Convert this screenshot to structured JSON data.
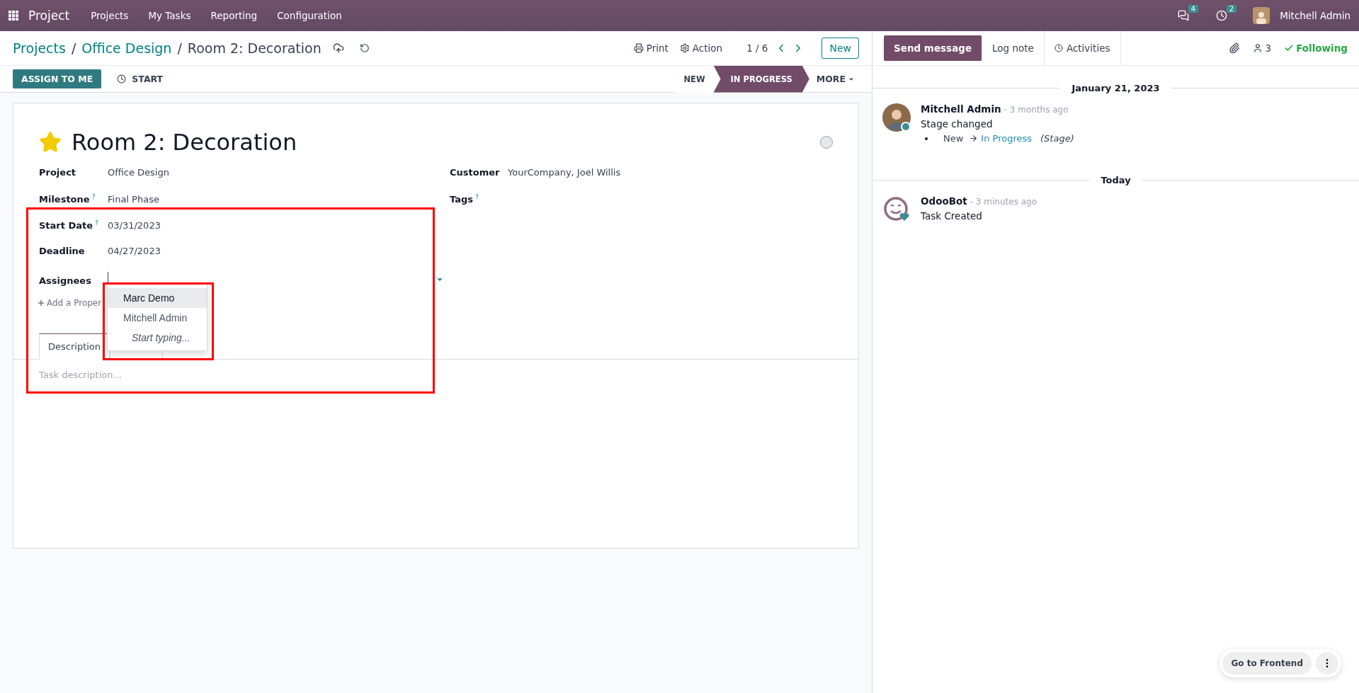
{
  "navbar": {
    "app": "Project",
    "menu": [
      "Projects",
      "My Tasks",
      "Reporting",
      "Configuration"
    ],
    "messages_count": "4",
    "activities_count": "2",
    "user": "Mitchell Admin"
  },
  "breadcrumbs": [
    "Projects",
    "Office Design",
    "Room 2: Decoration"
  ],
  "breadcrumb_separator": "/",
  "actions": [
    "Print",
    "Action"
  ],
  "pager": "1 / 6",
  "new_button": "New",
  "status_buttons": [
    {
      "label": "ASSIGN TO ME",
      "kind": "primary"
    },
    {
      "label": "START",
      "kind": "link"
    }
  ],
  "stages": [
    {
      "label": "NEW",
      "selected": false
    },
    {
      "label": "IN PROGRESS",
      "selected": true
    }
  ],
  "more": "MORE",
  "task": {
    "title": "Room 2: Decoration",
    "starred": true,
    "fields_left": [
      {
        "label": "Project",
        "value": "Office Design"
      },
      {
        "label": "Milestone",
        "help": "?",
        "value": "Final Phase"
      },
      {
        "label": "Start Date",
        "help": "?",
        "value": "03/31/2023"
      },
      {
        "label": "Deadline",
        "value": "04/27/2023"
      },
      {
        "label": "Assignees",
        "kind": "input"
      }
    ],
    "fields_right": [
      {
        "label": "Customer",
        "value": "YourCompany, Joel Willis"
      },
      {
        "label": "Tags",
        "help": "?"
      }
    ],
    "add_property": "Add a Proper",
    "dropdown": [
      {
        "label": "Marc Demo",
        "kind": "option",
        "selected": true
      },
      {
        "label": "Mitchell Admin",
        "kind": "option",
        "selected": false
      },
      {
        "label": "Start typing...",
        "kind": "hint",
        "selected": false
      }
    ],
    "tabs": [
      {
        "label": "Description",
        "selected": true
      }
    ],
    "description_placeholder": "Task description..."
  },
  "chatter": {
    "buttons": [
      {
        "label": "Send message",
        "selected": true
      },
      {
        "label": "Log note",
        "selected": false
      },
      {
        "label": "Activities",
        "selected": false
      }
    ],
    "followers": "3",
    "following": "Following",
    "groups": [
      {
        "date": "January 21, 2023",
        "messages": [
          {
            "author": "Mitchell Admin",
            "kind": "person",
            "time": "- 3 months ago",
            "body": "Stage changed",
            "change": {
              "from": "New",
              "to": "In Progress",
              "field": "(Stage)"
            }
          }
        ]
      },
      {
        "date": "Today",
        "messages": [
          {
            "author": "OdooBot",
            "kind": "bot",
            "time": "- 3 minutes ago",
            "body": "Task Created"
          }
        ]
      }
    ]
  },
  "frontend_button": "Go to Frontend"
}
